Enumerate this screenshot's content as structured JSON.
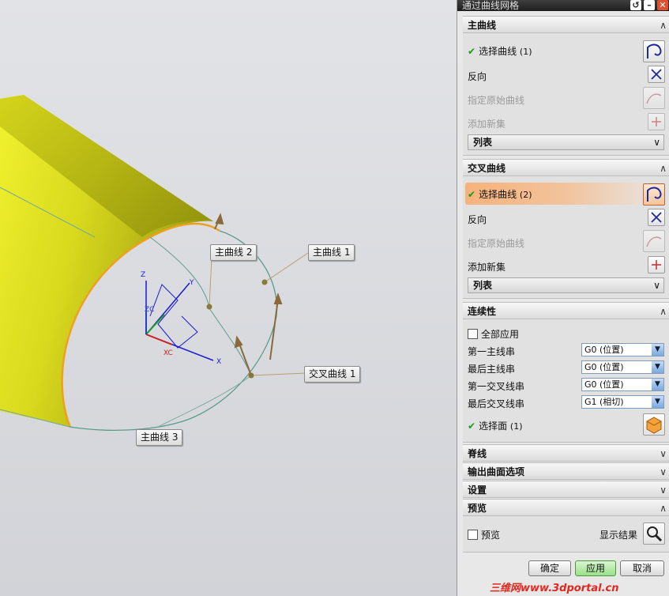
{
  "dialog": {
    "title": "通过曲线网格",
    "primary": {
      "header": "主曲线",
      "select_label": "选择曲线",
      "select_count": "(1)",
      "reverse": "反向",
      "specify_origin": "指定原始曲线",
      "add_new": "添加新集",
      "list": "列表"
    },
    "cross": {
      "header": "交叉曲线",
      "select_label": "选择曲线",
      "select_count": "(2)",
      "reverse": "反向",
      "specify_origin": "指定原始曲线",
      "add_new": "添加新集",
      "list": "列表"
    },
    "continuity": {
      "header": "连续性",
      "apply_all": "全部应用",
      "rows": [
        {
          "label": "第一主线串",
          "value": "G0 (位置)"
        },
        {
          "label": "最后主线串",
          "value": "G0 (位置)"
        },
        {
          "label": "第一交叉线串",
          "value": "G0 (位置)"
        },
        {
          "label": "最后交叉线串",
          "value": "G1 (相切)"
        }
      ],
      "select_face": "选择面",
      "select_face_count": "(1)"
    },
    "spine": "脊线",
    "output_options": "输出曲面选项",
    "settings": "设置",
    "preview": {
      "header": "预览",
      "checkbox": "预览",
      "show_result": "显示结果"
    },
    "buttons": {
      "ok": "确定",
      "apply": "应用",
      "cancel": "取消"
    }
  },
  "viewport": {
    "callouts": {
      "primary1": "主曲线 1",
      "primary2": "主曲线 2",
      "primary3": "主曲线 3",
      "cross1": "交叉曲线 1"
    },
    "axes": {
      "x": "X",
      "y": "Y",
      "z": "Z",
      "xc": "XC",
      "zc": "ZC"
    }
  },
  "watermark": "三维网www.3dportal.cn",
  "colors": {
    "surface": "#e6e62a",
    "edge": "#f0a020",
    "curve": "#5a9c8c",
    "accent": "#f2b07a"
  }
}
